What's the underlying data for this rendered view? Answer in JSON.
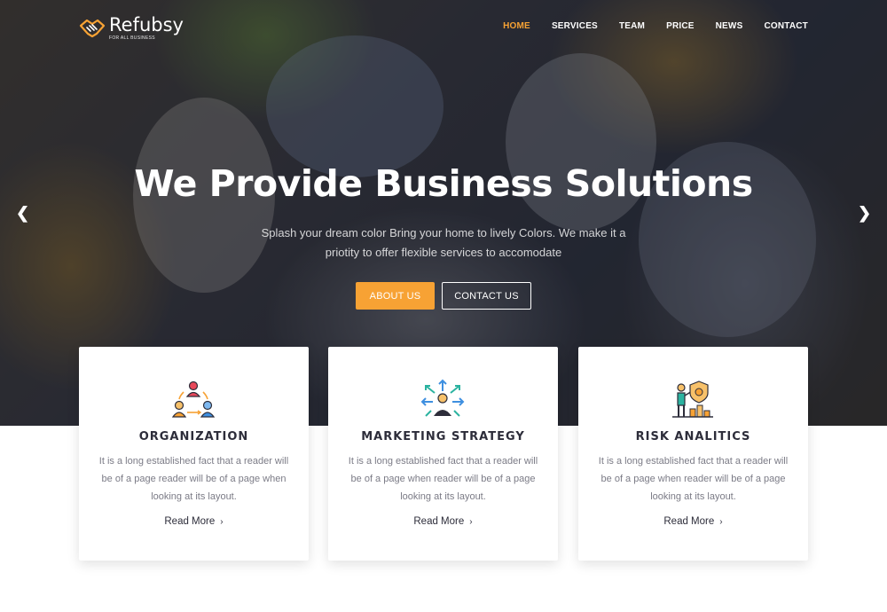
{
  "brand": {
    "name": "Refubsy",
    "tagline": "FOR ALL BUSINESS"
  },
  "nav": [
    {
      "label": "HOME",
      "active": true
    },
    {
      "label": "SERVICES"
    },
    {
      "label": "TEAM"
    },
    {
      "label": "PRICE"
    },
    {
      "label": "NEWS"
    },
    {
      "label": "CONTACT"
    }
  ],
  "hero": {
    "title": "We Provide Business Solutions",
    "subtitle": "Splash your dream color Bring your home to lively Colors. We make it a priotity to offer flexible services to accomodate",
    "primary_button": "ABOUT US",
    "secondary_button": "CONTACT US",
    "prev_icon": "chevron-left-icon",
    "next_icon": "chevron-right-icon"
  },
  "services": [
    {
      "icon": "organization-icon",
      "title": "ORGANIZATION",
      "text": "It is a long established fact that a reader will be of a page reader will be of a page when looking at its layout.",
      "link": "Read More"
    },
    {
      "icon": "marketing-strategy-icon",
      "title": "MARKETING STRATEGY",
      "text": "It is a long established fact that a reader will be of a page when reader will be of a page looking at its layout.",
      "link": "Read More"
    },
    {
      "icon": "risk-analytics-icon",
      "title": "RISK ANALITICS",
      "text": "It is a long established fact that a reader will be of a page when reader will be of a page looking at its layout.",
      "link": "Read More"
    }
  ],
  "colors": {
    "accent": "#f7a234",
    "heading": "#2d2d3a",
    "body_text": "#7b7b86"
  }
}
